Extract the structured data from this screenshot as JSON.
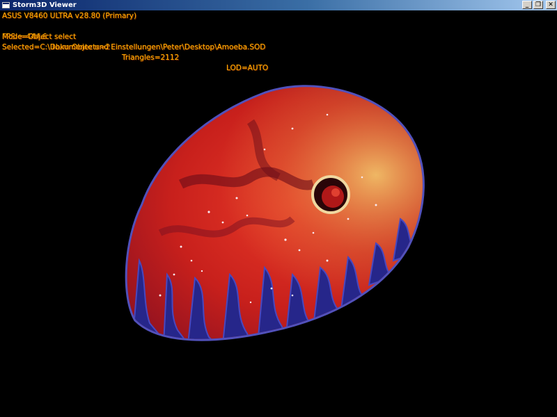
{
  "window": {
    "title": "Storm3D Viewer",
    "minimize_glyph": "_",
    "maximize_glyph": "❐",
    "close_glyph": "✕"
  },
  "hud": {
    "gpu": "ASUS V8460 ULTRA v28.80 (Primary)",
    "fps": "FPS = 444.6",
    "num_objects": "Num Objects=2",
    "triangles": "Triangles=2112",
    "lod": "LOD=AUTO",
    "mode": "Mode=Object select",
    "selected": "Selected=C:\\Dokumente und Einstellungen\\Peter\\Desktop\\Amoeba.SOD",
    "text_color": "#ffb000"
  },
  "scene": {
    "background": "#000000",
    "model_icon": "amoeba-model",
    "colors": {
      "body": "#d8261f",
      "body_dark": "#7a0f18",
      "highlight": "#f0c060",
      "rim": "#3a3aa0",
      "nucleus": "#b01010"
    }
  }
}
